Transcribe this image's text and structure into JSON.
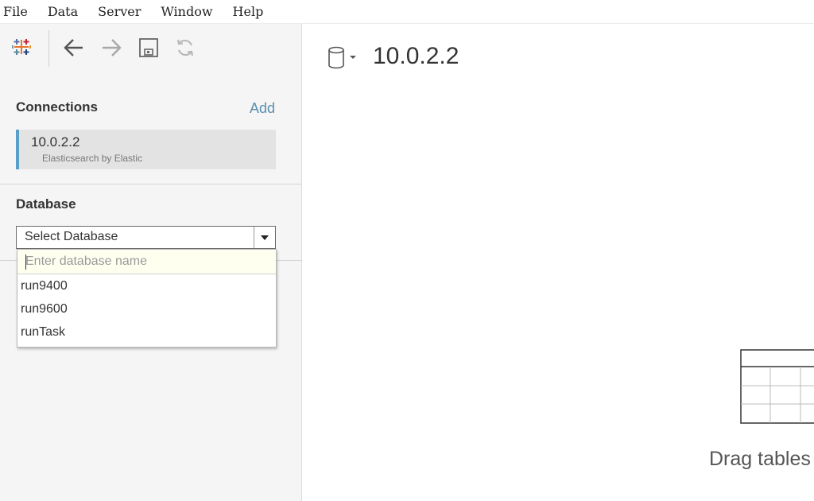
{
  "menu": {
    "items": [
      "File",
      "Data",
      "Server",
      "Window",
      "Help"
    ]
  },
  "toolbar": {
    "icons": [
      "tableau-logo-icon",
      "back-arrow-icon",
      "forward-arrow-icon",
      "save-icon",
      "refresh-icon"
    ]
  },
  "connections": {
    "title": "Connections",
    "add_label": "Add",
    "items": [
      {
        "name": "10.0.2.2",
        "type": "Elasticsearch by Elastic"
      }
    ]
  },
  "database": {
    "title": "Database",
    "select_label": "Select Database",
    "search_placeholder": "Enter database name",
    "options": [
      "run9400",
      "run9600",
      "runTask"
    ]
  },
  "main": {
    "datasource_title": "10.0.2.2",
    "drag_hint": "Drag tables"
  },
  "colors": {
    "accent": "#5b9ec7",
    "link": "#5b8fae",
    "sidebar_bg": "#f5f5f5"
  }
}
